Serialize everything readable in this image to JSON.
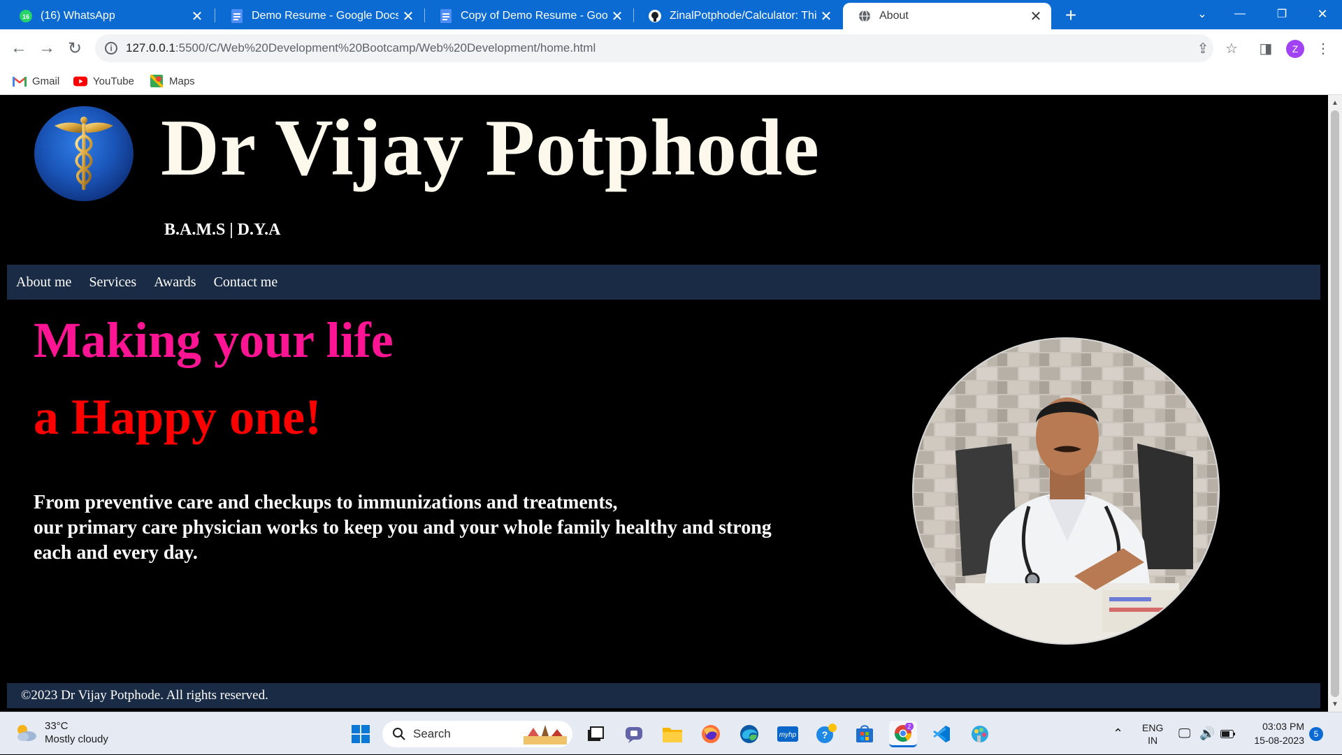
{
  "browser": {
    "tabs": [
      {
        "title": "(16) WhatsApp",
        "badge": "16",
        "icon": "whatsapp-icon",
        "active": false
      },
      {
        "title": "Demo Resume - Google Docs",
        "icon": "google-docs-icon",
        "active": false
      },
      {
        "title": "Copy of Demo Resume - Google",
        "icon": "google-docs-icon",
        "active": false
      },
      {
        "title": "ZinalPotphode/Calculator: This is",
        "icon": "github-icon",
        "active": false
      },
      {
        "title": "About",
        "icon": "globe-icon",
        "active": true
      }
    ],
    "new_tab_symbol": "+",
    "url_host": "127.0.0.1",
    "url_path": ":5500/C/Web%20Development%20Bootcamp/Web%20Development/home.html",
    "profile_initial": "Z",
    "bookmarks": [
      {
        "label": "Gmail",
        "icon": "gmail-icon"
      },
      {
        "label": "YouTube",
        "icon": "youtube-icon"
      },
      {
        "label": "Maps",
        "icon": "maps-icon"
      }
    ]
  },
  "page": {
    "title": "Dr Vijay Potphode",
    "subtitle": "B.A.M.S | D.Y.A",
    "nav": [
      "About me",
      "Services",
      "Awards",
      "Contact me"
    ],
    "hero_line1": "Making your life",
    "hero_line2": "a Happy one!",
    "blurb_lines": [
      "From preventive care and checkups to immunizations and treatments,",
      "our primary care physician works to keep you and your whole family healthy and strong",
      "each and every day."
    ],
    "footer": "©2023 Dr Vijay Potphode. All rights reserved.",
    "colors": {
      "hero_line1": "#ff1493",
      "hero_line2": "#ff0000",
      "nav_bg": "#1a2b45",
      "title": "#fcf8ec"
    }
  },
  "taskbar": {
    "weather_temp": "33°C",
    "weather_desc": "Mostly cloudy",
    "search_placeholder": "Search",
    "language": "ENG",
    "region": "IN",
    "time": "03:03 PM",
    "date": "15-08-2023",
    "notification_count": "5",
    "chrome_badge": "Z"
  },
  "colors": {
    "tab_strip": "#0b6bd2",
    "accent": "#0b6bd2"
  }
}
